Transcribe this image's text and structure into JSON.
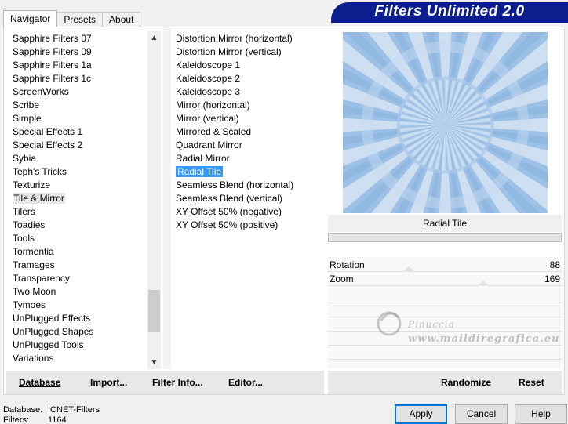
{
  "tabs": [
    {
      "label": "Navigator",
      "active": true
    },
    {
      "label": "Presets",
      "active": false
    },
    {
      "label": "About",
      "active": false
    }
  ],
  "banner": {
    "title": "Filters Unlimited 2.0"
  },
  "categories": {
    "items": [
      "Sapphire Filters 07",
      "Sapphire Filters 09",
      "Sapphire Filters 1a",
      "Sapphire Filters 1c",
      "ScreenWorks",
      "Scribe",
      "Simple",
      "Special Effects 1",
      "Special Effects 2",
      "Sybia",
      "Teph's Tricks",
      "Texturize",
      "Tile & Mirror",
      "Tilers",
      "Toadies",
      "Tools",
      "Tormentia",
      "Tramages",
      "Transparency",
      "Two Moon",
      "Tymoes",
      "UnPlugged Effects",
      "UnPlugged Shapes",
      "UnPlugged Tools",
      "Variations"
    ],
    "selected": "Tile & Mirror"
  },
  "filters": {
    "items": [
      "Distortion Mirror (horizontal)",
      "Distortion Mirror (vertical)",
      "Kaleidoscope 1",
      "Kaleidoscope 2",
      "Kaleidoscope 3",
      "Mirror (horizontal)",
      "Mirror (vertical)",
      "Mirrored & Scaled",
      "Quadrant Mirror",
      "Radial Mirror",
      "Radial Tile",
      "Seamless Blend (horizontal)",
      "Seamless Blend (vertical)",
      "XY Offset 50% (negative)",
      "XY Offset 50% (positive)"
    ],
    "selected": "Radial Tile"
  },
  "preview": {
    "filter_name": "Radial Tile"
  },
  "params": [
    {
      "label": "Rotation",
      "value": "88",
      "fraction": 0.345
    },
    {
      "label": "Zoom",
      "value": "169",
      "fraction": 0.663
    }
  ],
  "watermark": {
    "line1": "Pinuccia",
    "line2": "www.maildiregrafica.eu"
  },
  "left_buttons": {
    "database": "Database",
    "import": "Import...",
    "filter_info": "Filter Info...",
    "editor": "Editor..."
  },
  "right_buttons": {
    "randomize": "Randomize",
    "reset": "Reset"
  },
  "status": {
    "database_label": "Database:",
    "database_value": "ICNET-Filters",
    "filters_label": "Filters:",
    "filters_value": "1164"
  },
  "dialog_buttons": {
    "apply": "Apply",
    "cancel": "Cancel",
    "help": "Help"
  },
  "colors": {
    "banner": "#0c1d8e",
    "selection": "#3399ff",
    "preview_base": "#9cc0e6"
  }
}
